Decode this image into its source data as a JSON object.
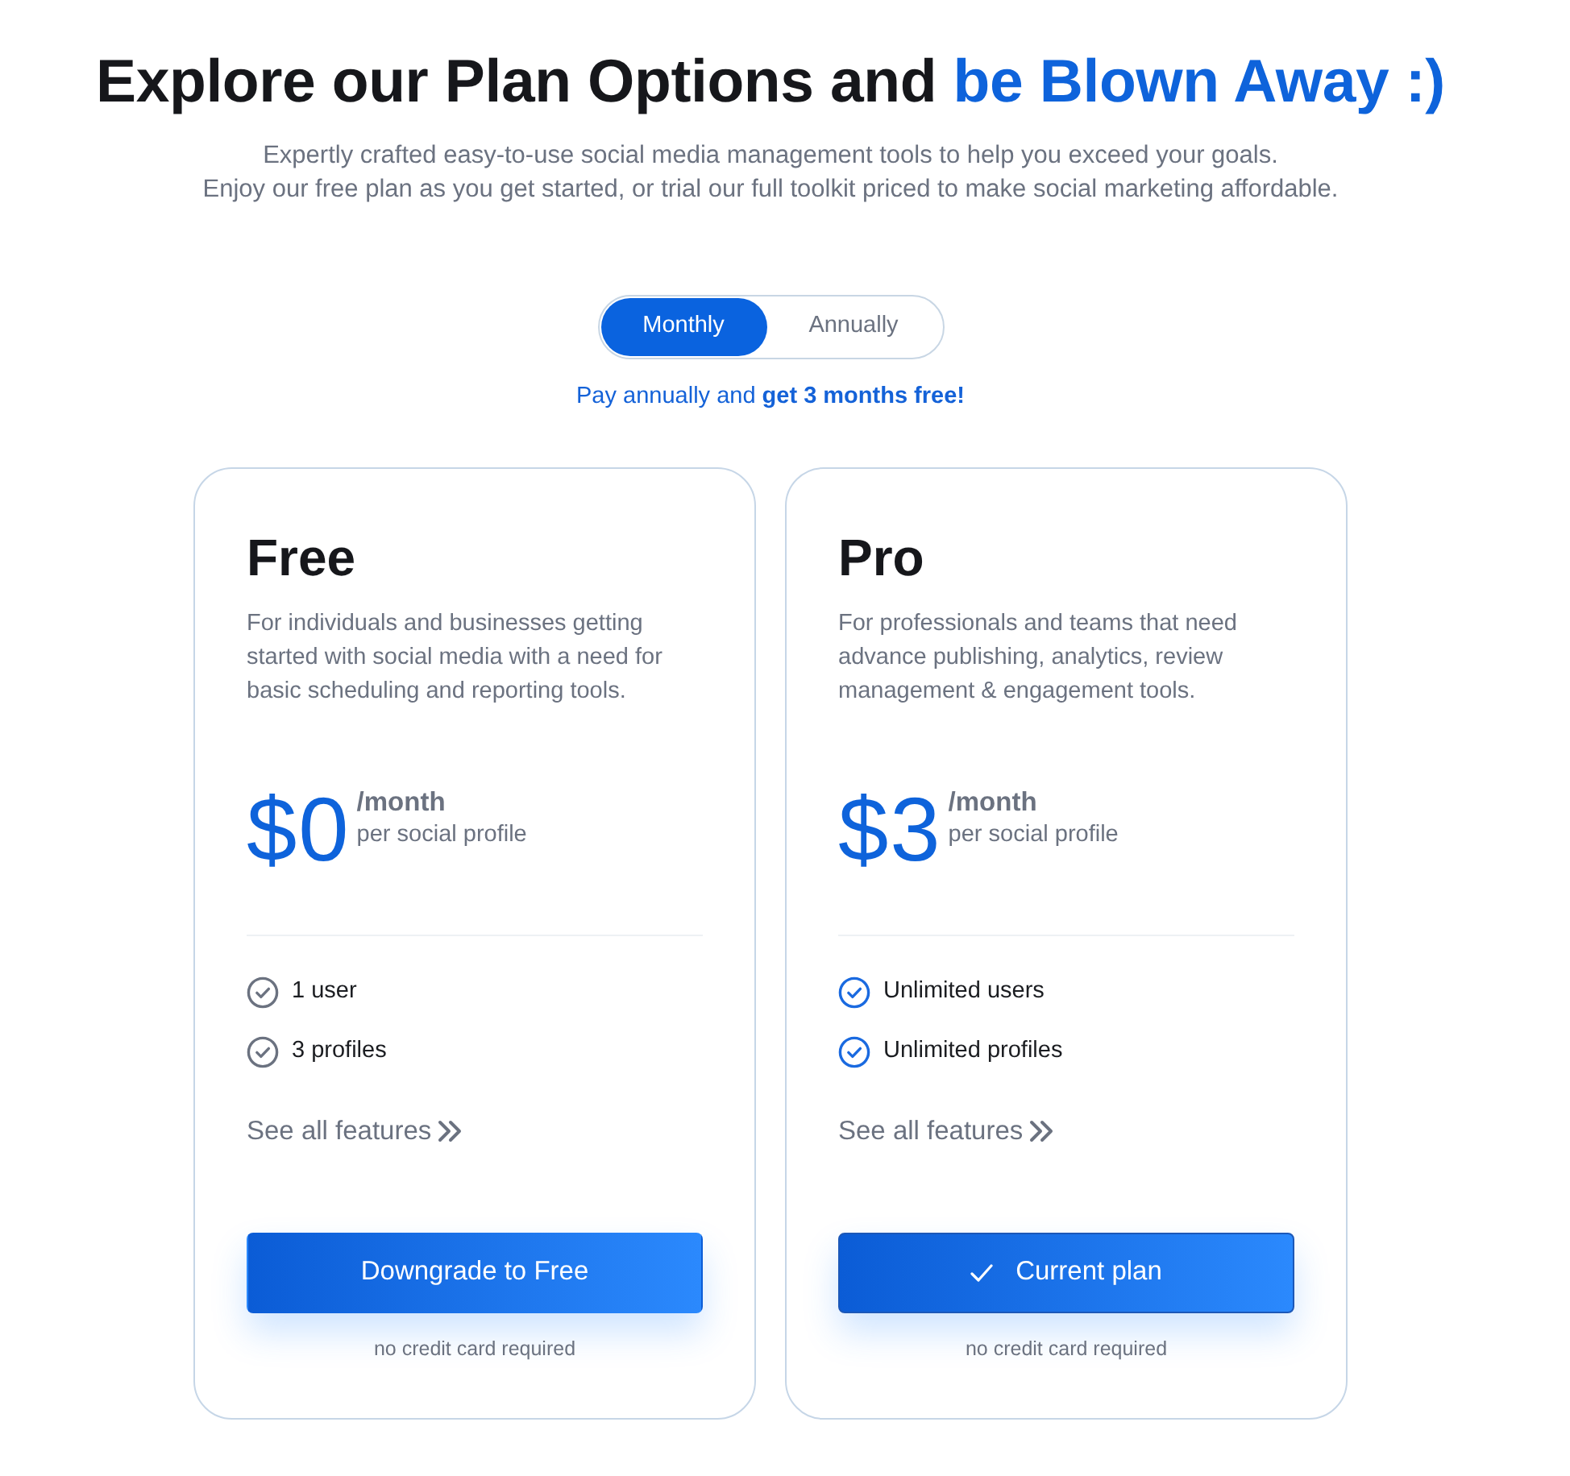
{
  "heading": {
    "text": "Explore our Plan Options and",
    "highlight": "be Blown Away :)"
  },
  "subtitle": [
    "Expertly crafted easy-to-use social media management tools to help you exceed your goals.",
    "Enjoy our free plan as you get started, or trial our full toolkit priced to make social marketing affordable."
  ],
  "billing_toggle": [
    {
      "label": "Monthly",
      "selected": true
    },
    {
      "label": "Annually",
      "selected": false
    }
  ],
  "promo": "Pay annually and **get 3 months free!**",
  "plans": [
    {
      "name": "Free",
      "description": "For individuals and businesses getting started with social media with a need for basic scheduling and reporting tools.",
      "price": "$0",
      "period": "/month",
      "unit": "per social profile",
      "features": [
        "1 user",
        "3 profiles"
      ],
      "link": "See all features",
      "button": "Downgrade to Free",
      "current": false,
      "note": "no credit card required"
    },
    {
      "name": "Pro",
      "description": "For professionals and teams that need advance publishing, analytics, review management & engagement tools.",
      "price": "$3",
      "period": "/month",
      "unit": "per social profile",
      "features": [
        "Unlimited users",
        "Unlimited profiles"
      ],
      "link": "See all features",
      "button": "Current plan",
      "current": true,
      "note": "no credit card required"
    }
  ]
}
